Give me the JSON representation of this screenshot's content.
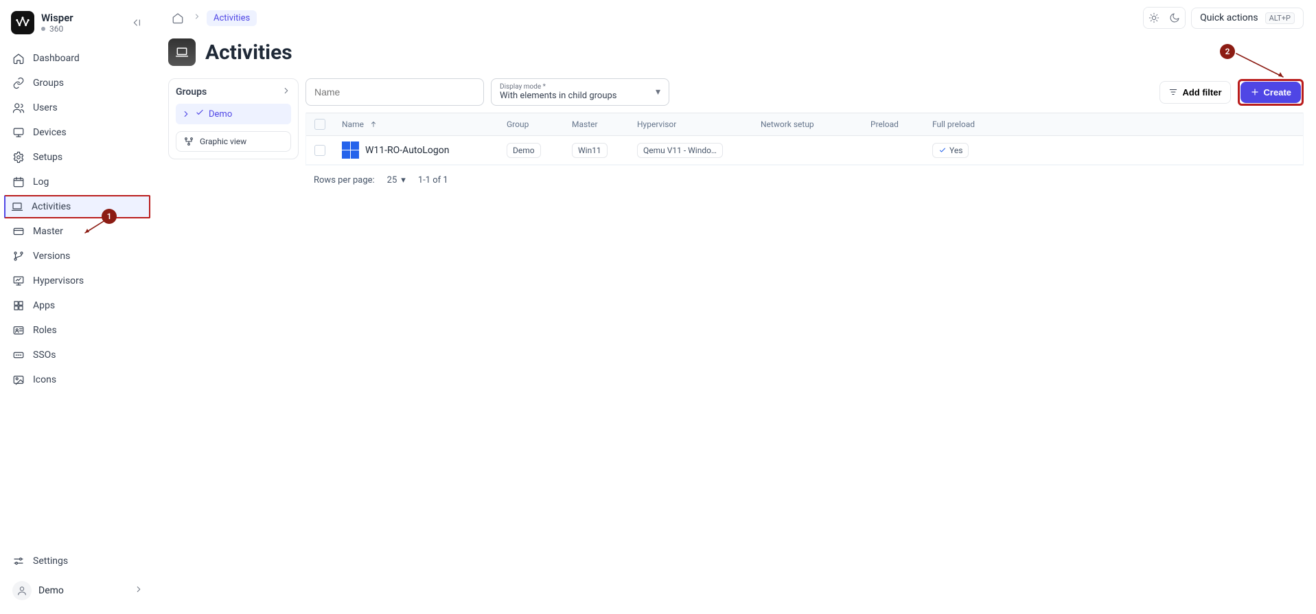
{
  "brand": {
    "name": "Wisper",
    "sub": "360"
  },
  "sidebar": {
    "items": [
      {
        "label": "Dashboard",
        "icon": "home"
      },
      {
        "label": "Groups",
        "icon": "link"
      },
      {
        "label": "Users",
        "icon": "users"
      },
      {
        "label": "Devices",
        "icon": "monitor"
      },
      {
        "label": "Setups",
        "icon": "gear"
      },
      {
        "label": "Log",
        "icon": "calendar"
      },
      {
        "label": "Activities",
        "icon": "laptop",
        "active": true
      },
      {
        "label": "Master",
        "icon": "card"
      },
      {
        "label": "Versions",
        "icon": "vcs"
      },
      {
        "label": "Hypervisors",
        "icon": "screenbar"
      },
      {
        "label": "Apps",
        "icon": "grid"
      },
      {
        "label": "Roles",
        "icon": "idcard"
      },
      {
        "label": "SSOs",
        "icon": "sso"
      },
      {
        "label": "Icons",
        "icon": "image"
      }
    ],
    "settings_label": "Settings",
    "user_label": "Demo"
  },
  "breadcrumb": {
    "current": "Activities"
  },
  "top": {
    "quick_actions": "Quick actions",
    "kbd": "ALT+P"
  },
  "page": {
    "title": "Activities"
  },
  "groups_panel": {
    "title": "Groups",
    "selected": "Demo",
    "graphic_btn": "Graphic view"
  },
  "filters": {
    "name_placeholder": "Name",
    "display_mode_label": "Display mode *",
    "display_mode_value": "With elements in child groups",
    "add_filter": "Add filter",
    "create": "Create"
  },
  "table": {
    "headers": {
      "name": "Name",
      "group": "Group",
      "master": "Master",
      "hypervisor": "Hypervisor",
      "network": "Network setup",
      "preload": "Preload",
      "full_preload": "Full preload"
    },
    "rows": [
      {
        "name": "W11-RO-AutoLogon",
        "group": "Demo",
        "master": "Win11",
        "hypervisor": "Qemu V11 - Windo…",
        "network": "",
        "preload": "",
        "full_preload": "Yes"
      }
    ],
    "footer": {
      "rows_per_page_label": "Rows per page:",
      "rows_per_page_value": "25",
      "range": "1-1 of 1"
    }
  },
  "annotations": {
    "dot1": "1",
    "dot2": "2"
  }
}
